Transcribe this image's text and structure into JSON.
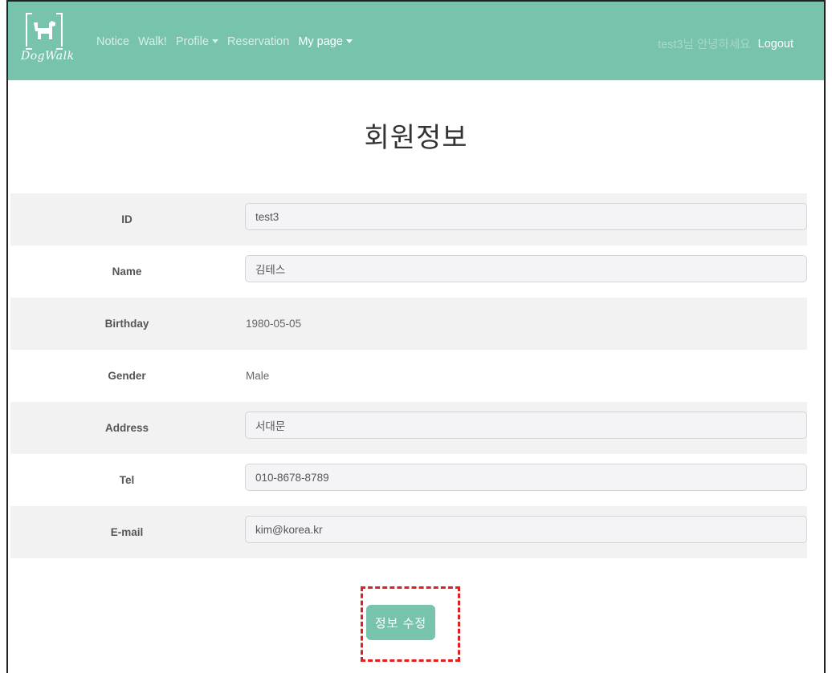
{
  "brand": {
    "name": "DogWalk",
    "icon": "dog-icon"
  },
  "nav": {
    "items": [
      {
        "label": "Notice",
        "dropdown": false,
        "active": false
      },
      {
        "label": "Walk!",
        "dropdown": false,
        "active": false
      },
      {
        "label": "Profile",
        "dropdown": true,
        "active": false
      },
      {
        "label": "Reservation",
        "dropdown": false,
        "active": false
      },
      {
        "label": "My page",
        "dropdown": true,
        "active": true
      }
    ],
    "greeting": "test3님 안녕하세요",
    "logout": "Logout"
  },
  "page": {
    "title": "회원정보"
  },
  "form": {
    "id": {
      "label": "ID",
      "value": "test3"
    },
    "name": {
      "label": "Name",
      "value": "김테스"
    },
    "birthday": {
      "label": "Birthday",
      "value": "1980-05-05"
    },
    "gender": {
      "label": "Gender",
      "value": "Male"
    },
    "address": {
      "label": "Address",
      "value": "서대문"
    },
    "tel": {
      "label": "Tel",
      "value": "010-8678-8789"
    },
    "email": {
      "label": "E-mail",
      "value": "kim@korea.kr"
    }
  },
  "actions": {
    "edit_label": "정보 수정"
  },
  "colors": {
    "navbar": "#78c3ad",
    "button": "#78c3ad",
    "row_shade": "#f2f2f2",
    "highlight": "#e02020"
  }
}
